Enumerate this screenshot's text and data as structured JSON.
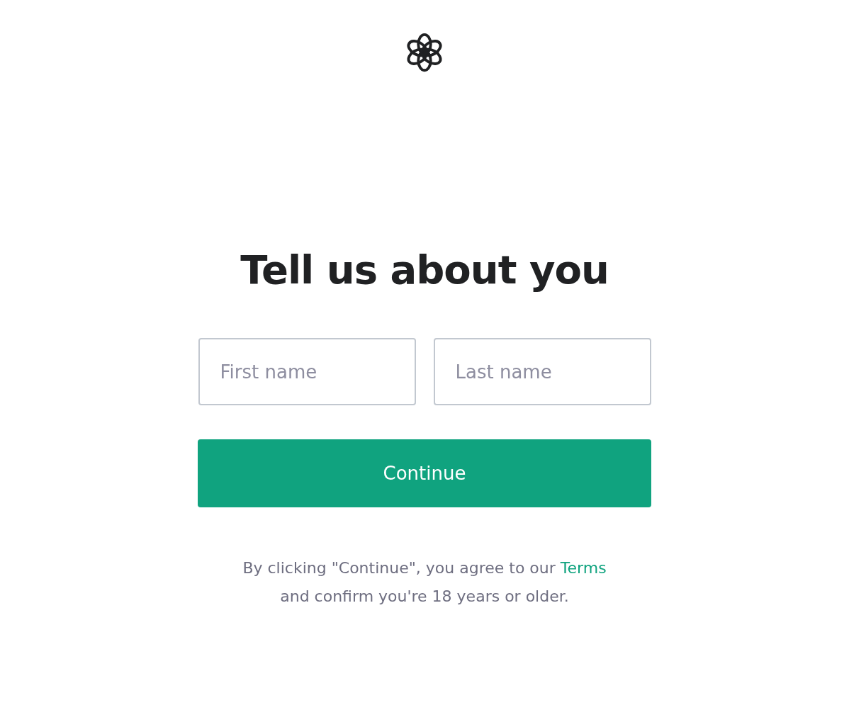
{
  "heading": "Tell us about you",
  "fields": [
    {
      "placeholder": "First name"
    },
    {
      "placeholder": "Last name"
    }
  ],
  "continue_button": "Continue",
  "notice": {
    "text": "By clicking \"Continue\", you agree to our ",
    "link": "Terms",
    "text_after": "and confirm you're 18 years or older."
  }
}
